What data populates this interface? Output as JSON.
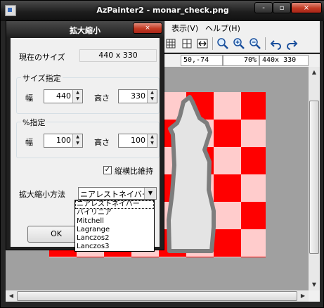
{
  "window": {
    "title": "AzPainter2 - monar_check.png",
    "min_label": "-",
    "max_label": "▫",
    "close_label": "×"
  },
  "menubar": {
    "items": [
      "表示(V)",
      "ヘルプ(H)"
    ]
  },
  "toolbar": {
    "icons": [
      "grid-icon",
      "grid-fine-icon",
      "fit-width-icon",
      "zoom-icon",
      "zoom-in-icon",
      "zoom-out-icon",
      "undo-icon",
      "redo-icon"
    ]
  },
  "statusbar": {
    "coords": "50,-74",
    "zoom": "70%",
    "size": "440x 330"
  },
  "dialog": {
    "title": "拡大縮小",
    "close_label": "×",
    "current_size_label": "現在のサイズ",
    "current_size_value": "440 x 330",
    "size_group_title": "サイズ指定",
    "width_label": "幅",
    "height_label": "高さ",
    "size_width": "440",
    "size_height": "330",
    "percent_group_title": "%指定",
    "pct_width": "100",
    "pct_height": "100",
    "keep_aspect_label": "縦横比維持",
    "keep_aspect_checked": true,
    "method_label": "拡大縮小方法",
    "method_value": "ニアレストネイバー",
    "ok_label": "OK"
  },
  "dropdown": {
    "options": [
      "ニアレストネイバー",
      "バイリニア",
      "Mitchell",
      "Lagrange",
      "Lanczos2",
      "Lanczos3"
    ],
    "selected": "ニアレストネイバー"
  },
  "colors": {
    "checker_red": "#ff0000",
    "checker_pink": "#ffcccc",
    "canvas_bg": "#a0a0a0",
    "close_red": "#c23a22"
  }
}
